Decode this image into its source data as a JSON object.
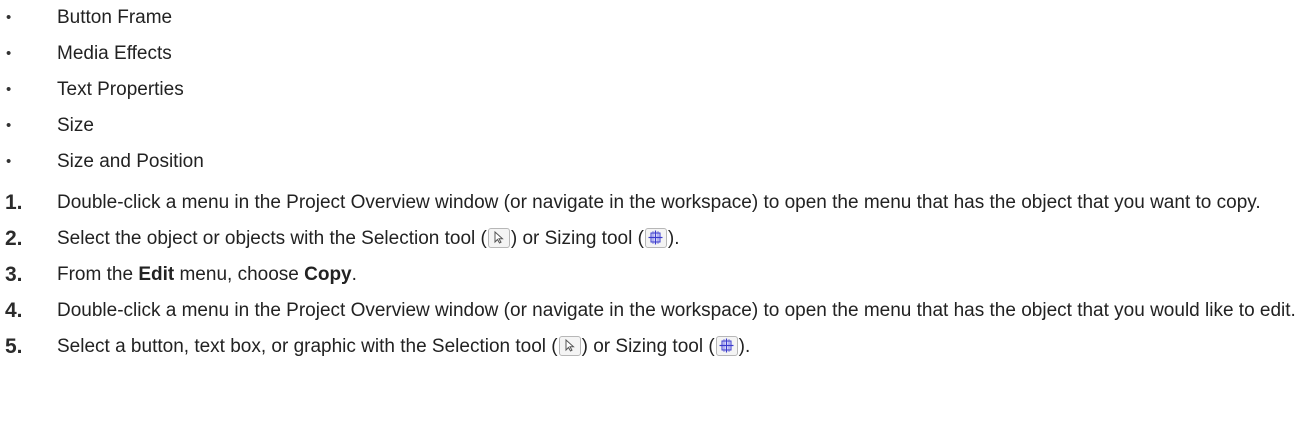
{
  "bullets": [
    "Button Frame",
    "Media Effects",
    "Text Properties",
    "Size",
    "Size and Position"
  ],
  "steps": [
    {
      "number": "1.",
      "text": "Double-click a menu in the Project Overview window (or navigate in the workspace) to open the menu that has the object that you want to copy."
    },
    {
      "number": "2.",
      "before": "Select the object or objects with the Selection tool (",
      "middle": ") or Sizing tool (",
      "after": ")."
    },
    {
      "number": "3.",
      "part1": "From the ",
      "bold1": "Edit",
      "part2": " menu, choose ",
      "bold2": "Copy",
      "part3": "."
    },
    {
      "number": "4.",
      "text": "Double-click a menu in the Project Overview window (or navigate in the workspace) to open the menu that has the object that you would like to edit."
    },
    {
      "number": "5.",
      "before": "Select a button, text box, or graphic with the Selection tool (",
      "middle": ") or Sizing tool (",
      "after": ")."
    }
  ],
  "icons": {
    "selection": "selection-tool-icon",
    "sizing": "sizing-tool-icon",
    "sizing_color": "#3a3acc"
  }
}
